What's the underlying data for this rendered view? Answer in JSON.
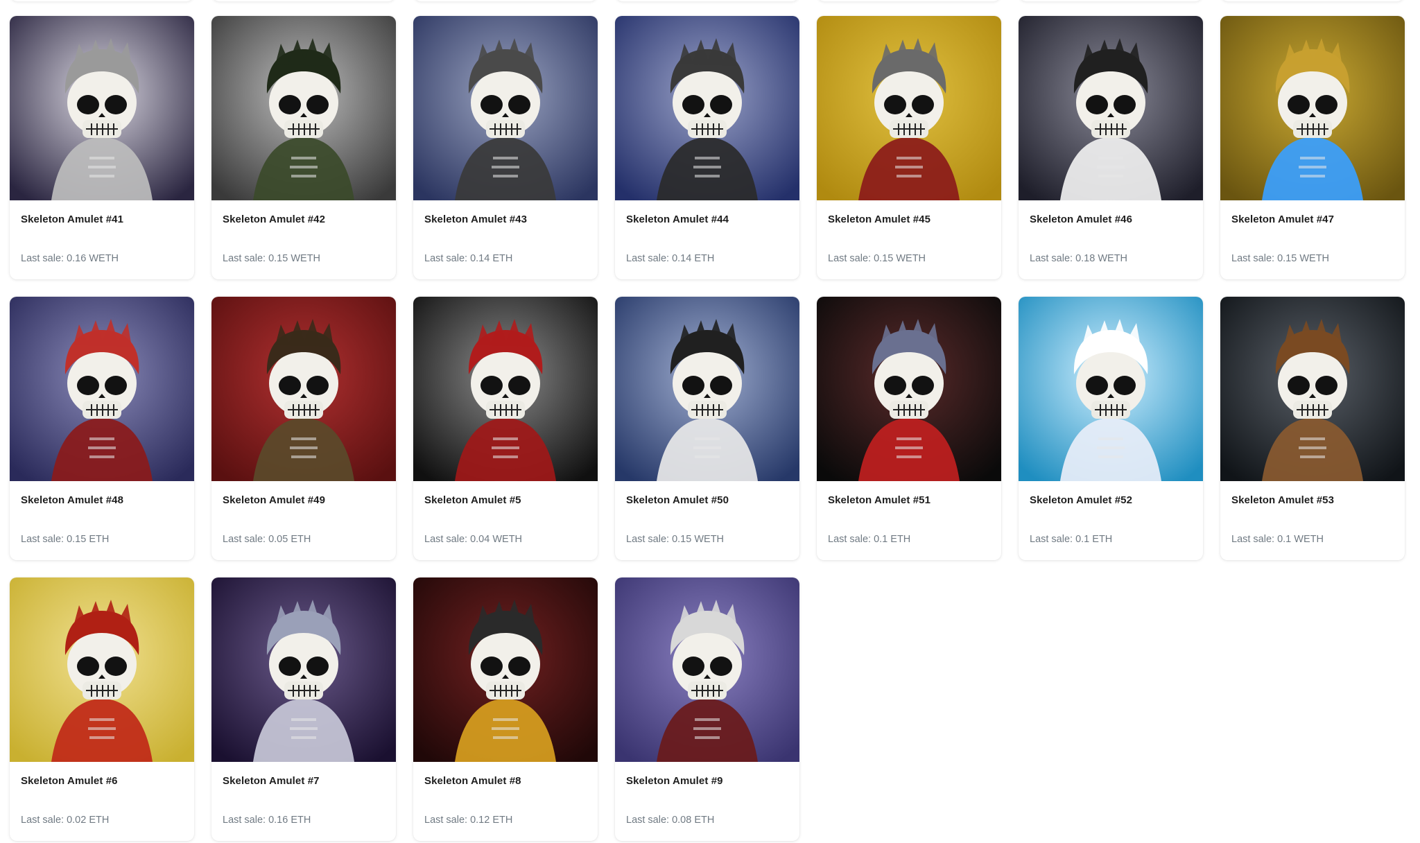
{
  "collection": {
    "items": [
      {
        "name": "Skeleton Amulet #41",
        "last_sale": "Last sale: 0.16 WETH",
        "bg": [
          "#2a2540",
          "#d9d6e0"
        ],
        "accent": "#bdbdbd",
        "hair": "#9a9a9a"
      },
      {
        "name": "Skeleton Amulet #42",
        "last_sale": "Last sale: 0.15 WETH",
        "bg": [
          "#3a3a3a",
          "#bcbcbc"
        ],
        "accent": "#3b4a2a",
        "hair": "#1f2a18"
      },
      {
        "name": "Skeleton Amulet #43",
        "last_sale": "Last sale: 0.14 ETH",
        "bg": [
          "#2b3560",
          "#9aa3c0"
        ],
        "accent": "#3a3a3a",
        "hair": "#4a4a4a"
      },
      {
        "name": "Skeleton Amulet #44",
        "last_sale": "Last sale: 0.14 ETH",
        "bg": [
          "#24306a",
          "#9aa2c8"
        ],
        "accent": "#2a2a2a",
        "hair": "#3a3a3a"
      },
      {
        "name": "Skeleton Amulet #45",
        "last_sale": "Last sale: 0.15 WETH",
        "bg": [
          "#b08a10",
          "#e0c040"
        ],
        "accent": "#8b1a1a",
        "hair": "#6a6a6a"
      },
      {
        "name": "Skeleton Amulet #46",
        "last_sale": "Last sale: 0.18 WETH",
        "bg": [
          "#1e1e2a",
          "#8a8a98"
        ],
        "accent": "#f0f0f0",
        "hair": "#202020"
      },
      {
        "name": "Skeleton Amulet #47",
        "last_sale": "Last sale: 0.15 WETH",
        "bg": [
          "#6a5510",
          "#c9a832"
        ],
        "accent": "#3aa0ff",
        "hair": "#c8a030"
      },
      {
        "name": "Skeleton Amulet #48",
        "last_sale": "Last sale: 0.15 ETH",
        "bg": [
          "#2a2a5a",
          "#8a8ab8"
        ],
        "accent": "#8b1a1a",
        "hair": "#c0302a"
      },
      {
        "name": "Skeleton Amulet #49",
        "last_sale": "Last sale: 0.05 ETH",
        "bg": [
          "#5a1010",
          "#b03030"
        ],
        "accent": "#5a4a2a",
        "hair": "#3a2a1a"
      },
      {
        "name": "Skeleton Amulet #5",
        "last_sale": "Last sale: 0.04 WETH",
        "bg": [
          "#101010",
          "#8a8a8a"
        ],
        "accent": "#a01818",
        "hair": "#b01c1c"
      },
      {
        "name": "Skeleton Amulet #50",
        "last_sale": "Last sale: 0.15 WETH",
        "bg": [
          "#263868",
          "#a0aed0"
        ],
        "accent": "#e8e8e8",
        "hair": "#202020"
      },
      {
        "name": "Skeleton Amulet #51",
        "last_sale": "Last sale: 0.1 ETH",
        "bg": [
          "#0a0a0a",
          "#5a2a2a"
        ],
        "accent": "#c02020",
        "hair": "#6a7090"
      },
      {
        "name": "Skeleton Amulet #52",
        "last_sale": "Last sale: 0.1 ETH",
        "bg": [
          "#1f8ec0",
          "#cfefff"
        ],
        "accent": "#e8eef8",
        "hair": "#ffffff"
      },
      {
        "name": "Skeleton Amulet #53",
        "last_sale": "Last sale: 0.1 WETH",
        "bg": [
          "#101418",
          "#5a6068"
        ],
        "accent": "#8a5a30",
        "hair": "#7a4a22"
      },
      {
        "name": "Skeleton Amulet #6",
        "last_sale": "Last sale: 0.02 ETH",
        "bg": [
          "#c9b030",
          "#f0e090"
        ],
        "accent": "#c02818",
        "hair": "#b02014"
      },
      {
        "name": "Skeleton Amulet #7",
        "last_sale": "Last sale: 0.16 ETH",
        "bg": [
          "#1a1030",
          "#6a5a8a"
        ],
        "accent": "#c8c8d8",
        "hair": "#9aa0b8"
      },
      {
        "name": "Skeleton Amulet #8",
        "last_sale": "Last sale: 0.12 ETH",
        "bg": [
          "#200808",
          "#702020"
        ],
        "accent": "#d8a020",
        "hair": "#2a2a2a"
      },
      {
        "name": "Skeleton Amulet #9",
        "last_sale": "Last sale: 0.08 ETH",
        "bg": [
          "#3a3470",
          "#8a80c0"
        ],
        "accent": "#6a1a1a",
        "hair": "#d8d8d8"
      }
    ]
  }
}
